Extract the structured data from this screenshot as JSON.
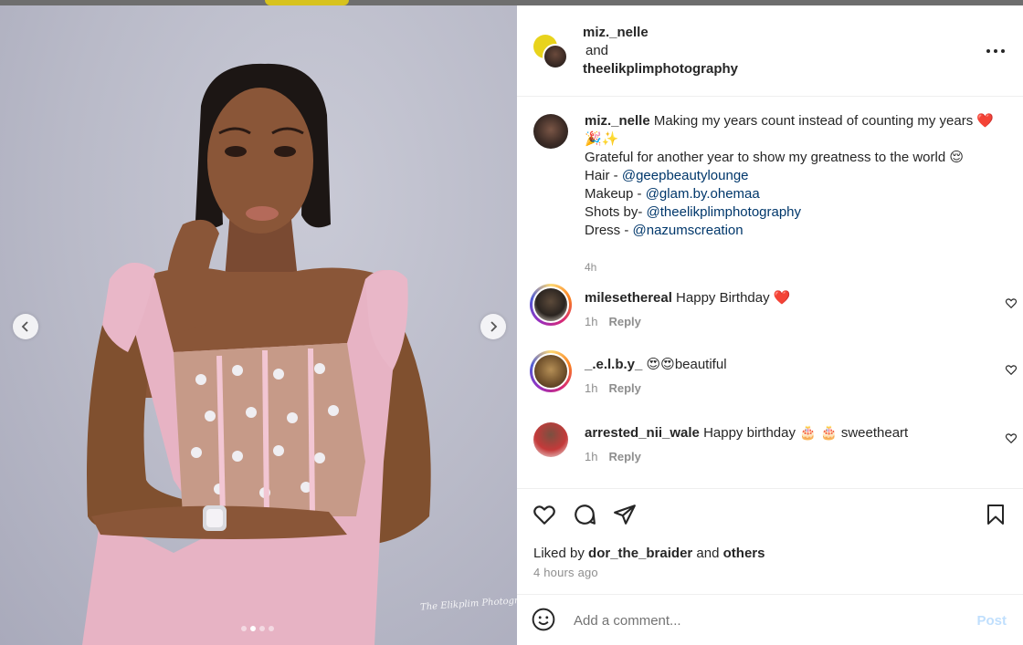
{
  "post_header": {
    "author": "miz._nelle",
    "conjunction": "and",
    "collaborator": "theelikplimphotography",
    "more_icon": "more-horizontal-icon"
  },
  "photo": {
    "watermark": "The Elikplim Photography",
    "carousel_dots": 4,
    "active_dot": 2,
    "prev_icon": "chevron-left-icon",
    "next_icon": "chevron-right-icon"
  },
  "caption": {
    "user": "miz._nelle",
    "line1": " Making my years count instead of counting my years ❤️🎉✨",
    "line2": "Grateful for another year to show my greatness to the world 😌",
    "hair_label": "Hair - ",
    "hair_mention": "@geepbeautylounge",
    "makeup_label": "Makeup - ",
    "makeup_mention": "@glam.by.ohemaa",
    "shots_label": "Shots by- ",
    "shots_mention": "@theelikplimphotography",
    "dress_label": "Dress - ",
    "dress_mention": "@nazumscreation",
    "time": "4h"
  },
  "comments": [
    {
      "user": "milesethereal",
      "text": " Happy Birthday ❤️",
      "time": "1h",
      "reply": "Reply"
    },
    {
      "user": "_.e.l.b.y_",
      "text": " 😍😍beautiful",
      "time": "1h",
      "reply": "Reply"
    },
    {
      "user": "arrested_nii_wale",
      "text": " Happy birthday 🎂 🎂 sweetheart",
      "time": "1h",
      "reply": "Reply"
    }
  ],
  "actions": {
    "like_icon": "heart-icon",
    "comment_icon": "comment-icon",
    "share_icon": "send-icon",
    "save_icon": "bookmark-icon"
  },
  "likes": {
    "prefix": "Liked by ",
    "user": "dor_the_braider",
    "middle": " and ",
    "others": "others"
  },
  "post_time": "4 hours ago",
  "add_comment": {
    "placeholder": "Add a comment...",
    "post_label": "Post",
    "emoji_icon": "emoji-icon"
  },
  "colors": {
    "link": "#00376b",
    "muted": "#8e8e8e",
    "post_disabled": "#c0dffd"
  }
}
